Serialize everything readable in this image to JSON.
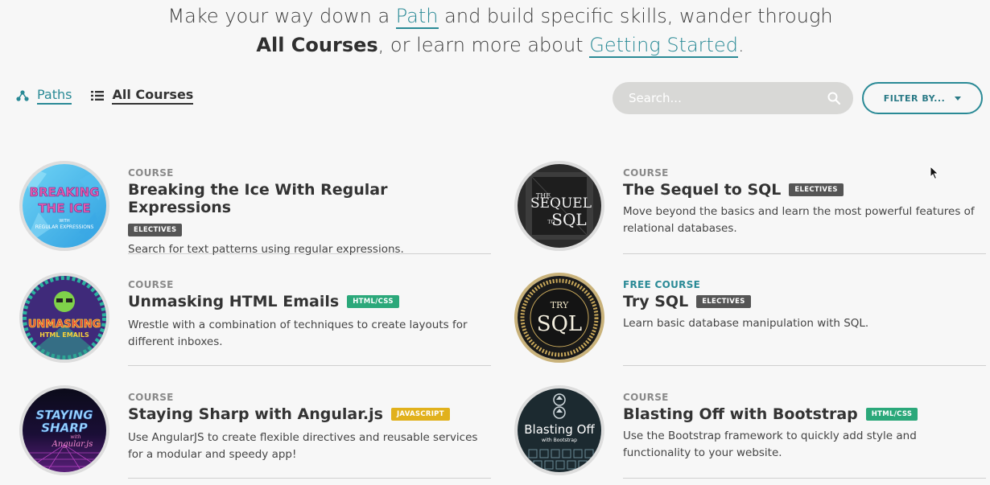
{
  "intro": {
    "line1_before": "Make your way down a ",
    "path_link": "Path",
    "line1_after": " and build specific skills, wander through",
    "all_courses": "All Courses",
    "line2_mid": ", or learn more about ",
    "getting_started_link": "Getting Started",
    "line2_end": "."
  },
  "view_toggle": {
    "paths_label": "Paths",
    "all_courses_label": "All Courses"
  },
  "search": {
    "placeholder": "Search..."
  },
  "filter": {
    "label": "FILTER BY..."
  },
  "colors": {
    "teal": "#2a8a96",
    "electives": "#555555",
    "html_css": "#2ba87a",
    "javascript": "#e1b11c"
  },
  "courses": [
    {
      "kind": "COURSE",
      "title": "Breaking the Ice With Regular Expressions",
      "badge": "ELECTIVES",
      "description": "Search for text patterns using regular expressions.",
      "thumb_text": [
        "BREAKING",
        "THE ICE",
        "WITH",
        "REGULAR EXPRESSIONS"
      ]
    },
    {
      "kind": "COURSE",
      "title": "The Sequel to SQL",
      "badge": "ELECTIVES",
      "description": "Move beyond the basics and learn the most powerful features of relational databases.",
      "thumb_text": [
        "THE",
        "SEQUEL",
        "TO",
        "SQL"
      ]
    },
    {
      "kind": "COURSE",
      "title": "Unmasking HTML Emails",
      "badge": "HTML/CSS",
      "description": "Wrestle with a combination of techniques to create layouts for different inboxes.",
      "thumb_text": [
        "UNMASKING",
        "HTML EMAILS"
      ]
    },
    {
      "kind": "FREE COURSE",
      "title": "Try SQL",
      "badge": "ELECTIVES",
      "description": "Learn basic database manipulation with SQL.",
      "thumb_text": [
        "TRY",
        "SQL"
      ]
    },
    {
      "kind": "COURSE",
      "title": "Staying Sharp with Angular.js",
      "badge": "JAVASCRIPT",
      "description": "Use AngularJS to create flexible directives and reusable services for a modular and speedy app!",
      "thumb_text": [
        "STAYING",
        "SHARP",
        "with",
        "Angular.js"
      ]
    },
    {
      "kind": "COURSE",
      "title": "Blasting Off with Bootstrap",
      "badge": "HTML/CSS",
      "description": "Use the Bootstrap framework to quickly add style and functionality to your website.",
      "thumb_text": [
        "Blasting Off",
        "with Bootstrap"
      ]
    }
  ]
}
